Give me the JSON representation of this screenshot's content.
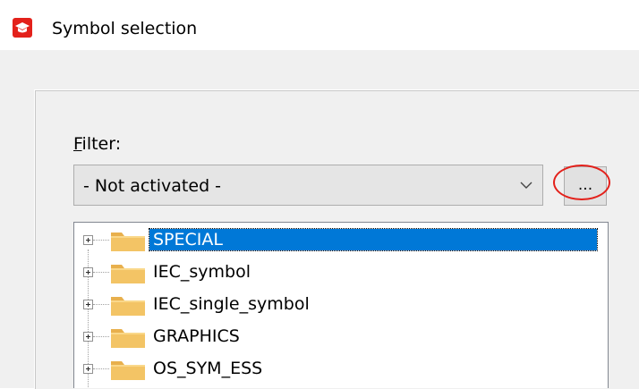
{
  "window": {
    "title": "Symbol selection",
    "icon": "app-logo-icon",
    "accent_color": "#e3211b"
  },
  "filter": {
    "label_prefix": "F",
    "label_rest": "ilter:",
    "selected_value": "- Not activated -",
    "browse_label": "..."
  },
  "tree": {
    "nodes": [
      {
        "label": "SPECIAL",
        "selected": true
      },
      {
        "label": "IEC_symbol",
        "selected": false
      },
      {
        "label": "IEC_single_symbol",
        "selected": false
      },
      {
        "label": "GRAPHICS",
        "selected": false
      },
      {
        "label": "OS_SYM_ESS",
        "selected": false
      }
    ],
    "selection_color": "#0078d7"
  }
}
